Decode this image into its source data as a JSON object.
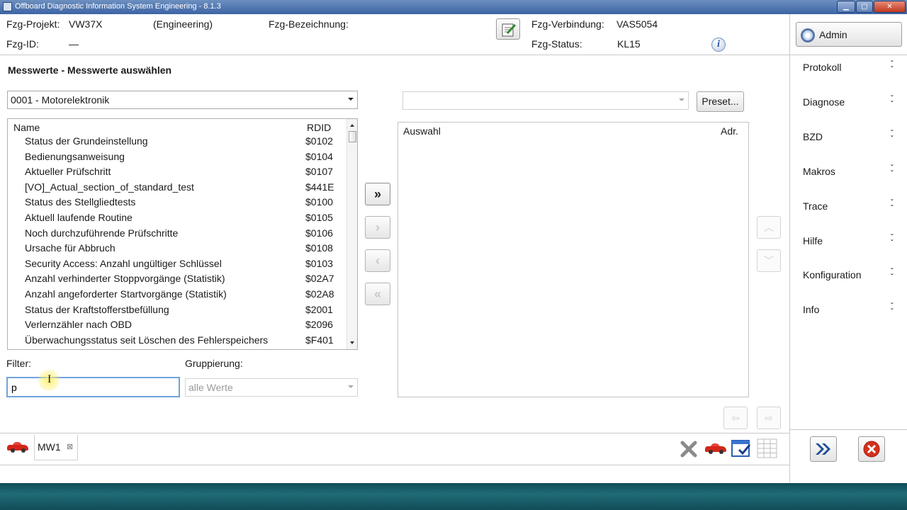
{
  "window": {
    "title": "Offboard Diagnostic Information System Engineering - 8.1.3"
  },
  "header": {
    "project_label": "Fzg-Projekt:",
    "project_value": "VW37X",
    "project_mode": "(Engineering)",
    "designation_label": "Fzg-Bezeichnung:",
    "id_label": "Fzg-ID:",
    "id_value": "—",
    "connection_label": "Fzg-Verbindung:",
    "connection_value": "VAS5054",
    "status_label": "Fzg-Status:",
    "status_value": "KL15",
    "notepad_icon": "notepad-icon",
    "info_icon": "info-icon"
  },
  "sidebar": {
    "admin_label": "Admin",
    "items": [
      {
        "label": "Protokoll"
      },
      {
        "label": "Diagnose"
      },
      {
        "label": "BZD"
      },
      {
        "label": "Makros"
      },
      {
        "label": "Trace"
      },
      {
        "label": "Hilfe"
      },
      {
        "label": "Konfiguration"
      },
      {
        "label": "Info"
      }
    ]
  },
  "main": {
    "title": "Messwerte - Messwerte auswählen",
    "ecu_select": "0001 - Motorelektronik",
    "preset_select": "",
    "preset_button": "Preset...",
    "list_headers": {
      "name": "Name",
      "rdid": "RDID"
    },
    "rows": [
      {
        "name": "Status der Grundeinstellung",
        "rdid": "$0102"
      },
      {
        "name": "Bedienungsanweisung",
        "rdid": "$0104"
      },
      {
        "name": "Aktueller Prüfschritt",
        "rdid": "$0107"
      },
      {
        "name": "[VO]_Actual_section_of_standard_test",
        "rdid": "$441E"
      },
      {
        "name": "Status des Stellgliedtests",
        "rdid": "$0100"
      },
      {
        "name": "Aktuell laufende Routine",
        "rdid": "$0105"
      },
      {
        "name": "Noch durchzuführende Prüfschritte",
        "rdid": "$0106"
      },
      {
        "name": "Ursache für Abbruch",
        "rdid": "$0108"
      },
      {
        "name": "Security Access: Anzahl ungültiger Schlüssel",
        "rdid": "$0103"
      },
      {
        "name": "Anzahl verhinderter Stoppvorgänge (Statistik)",
        "rdid": "$02A7"
      },
      {
        "name": "Anzahl angeforderter Startvorgänge (Statistik)",
        "rdid": "$02A8"
      },
      {
        "name": "Status der Kraftstofferstbefüllung",
        "rdid": "$2001"
      },
      {
        "name": "Verlernzähler nach OBD",
        "rdid": "$2096"
      },
      {
        "name": "Überwachungsstatus seit Löschen des Fehlerspeichers",
        "rdid": "$F401"
      }
    ],
    "selection_headers": {
      "name": "Auswahl",
      "adr": "Adr."
    },
    "filter_label": "Filter:",
    "filter_value": "p",
    "grouping_label": "Gruppierung:",
    "grouping_value": "alle Werte"
  },
  "tabs": [
    {
      "label": "MW1"
    }
  ],
  "colors": {
    "accent_blue": "#1e4c99",
    "title_bar": "#3c64a4",
    "close_red": "#d6301f",
    "filter_border": "#6fa3dc"
  }
}
